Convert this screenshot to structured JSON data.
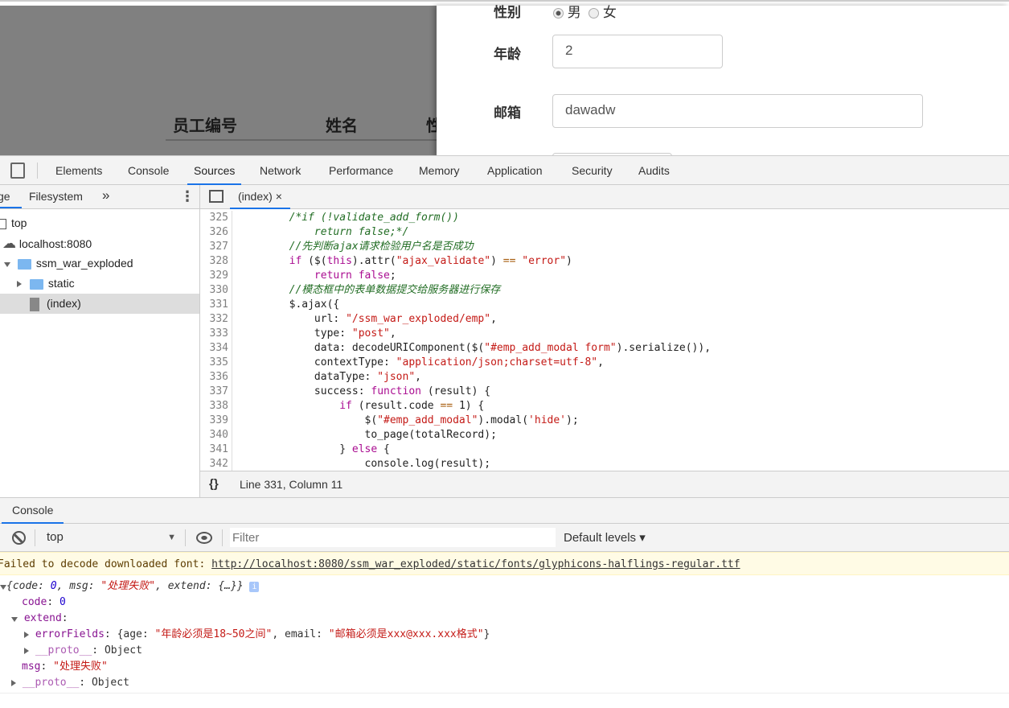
{
  "page": {
    "table_headers": [
      "员工编号",
      "姓名",
      "性"
    ],
    "form": {
      "gender_label": "性别",
      "gender_options": [
        {
          "label": "男",
          "checked": true
        },
        {
          "label": "女",
          "checked": false
        }
      ],
      "age_label": "年龄",
      "age_value": "2",
      "email_label": "邮箱",
      "email_value": "dawadw"
    }
  },
  "devtools": {
    "tabs": [
      "Elements",
      "Console",
      "Sources",
      "Network",
      "Performance",
      "Memory",
      "Application",
      "Security",
      "Audits"
    ],
    "active_tab": "Sources",
    "accent_color": "#1a73e8",
    "navigator": {
      "tabs": [
        "ge",
        "Filesystem"
      ],
      "more": "»",
      "tree": [
        {
          "label": "top",
          "icon": "frame-icon"
        },
        {
          "label": "localhost:8080",
          "icon": "cloud-icon"
        },
        {
          "label": "ssm_war_exploded",
          "icon": "folder-icon",
          "expanded": true
        },
        {
          "label": "static",
          "icon": "folder-icon",
          "expanded": false
        },
        {
          "label": "(index)",
          "icon": "file-icon",
          "selected": true
        }
      ]
    },
    "editor": {
      "tab": "(index)",
      "close": "×",
      "lines": [
        {
          "n": "325",
          "t": [
            [
              "p",
              "        "
            ],
            [
              "c",
              "/*if (!validate_add_form())"
            ]
          ]
        },
        {
          "n": "326",
          "t": [
            [
              "p",
              "            "
            ],
            [
              "c",
              "return false;*/"
            ]
          ]
        },
        {
          "n": "327",
          "t": [
            [
              "p",
              "        "
            ],
            [
              "c",
              "//先判断ajax请求检验用户名是否成功"
            ]
          ]
        },
        {
          "n": "328",
          "t": [
            [
              "p",
              "        "
            ],
            [
              "k",
              "if"
            ],
            [
              "p",
              " ($("
            ],
            [
              "k",
              "this"
            ],
            [
              "p",
              ").attr("
            ],
            [
              "s",
              "\"ajax_validate\""
            ],
            [
              "p",
              ") "
            ],
            [
              "o",
              "=="
            ],
            [
              "p",
              " "
            ],
            [
              "s",
              "\"error\""
            ],
            [
              "p",
              ")"
            ]
          ]
        },
        {
          "n": "329",
          "t": [
            [
              "p",
              "            "
            ],
            [
              "k",
              "return"
            ],
            [
              "p",
              " "
            ],
            [
              "k",
              "false"
            ],
            [
              "p",
              ";"
            ]
          ]
        },
        {
          "n": "330",
          "t": [
            [
              "p",
              "        "
            ],
            [
              "c",
              "//模态框中的表单数据提交给服务器进行保存"
            ]
          ]
        },
        {
          "n": "331",
          "t": [
            [
              "p",
              "        $.ajax({"
            ]
          ]
        },
        {
          "n": "332",
          "t": [
            [
              "p",
              "            url: "
            ],
            [
              "s",
              "\"/ssm_war_exploded/emp\""
            ],
            [
              "p",
              ","
            ]
          ]
        },
        {
          "n": "333",
          "t": [
            [
              "p",
              "            type: "
            ],
            [
              "s",
              "\"post\""
            ],
            [
              "p",
              ","
            ]
          ]
        },
        {
          "n": "334",
          "t": [
            [
              "p",
              "            data: decodeURIComponent($("
            ],
            [
              "s",
              "\"#emp_add_modal form\""
            ],
            [
              "p",
              ").serialize()),"
            ]
          ]
        },
        {
          "n": "335",
          "t": [
            [
              "p",
              "            contextType: "
            ],
            [
              "s",
              "\"application/json;charset=utf-8\""
            ],
            [
              "p",
              ","
            ]
          ]
        },
        {
          "n": "336",
          "t": [
            [
              "p",
              "            dataType: "
            ],
            [
              "s",
              "\"json\""
            ],
            [
              "p",
              ","
            ]
          ]
        },
        {
          "n": "337",
          "t": [
            [
              "p",
              "            success: "
            ],
            [
              "k",
              "function"
            ],
            [
              "p",
              " (result) {"
            ]
          ]
        },
        {
          "n": "338",
          "t": [
            [
              "p",
              "                "
            ],
            [
              "k",
              "if"
            ],
            [
              "p",
              " (result.code "
            ],
            [
              "o",
              "=="
            ],
            [
              "p",
              " 1) {"
            ]
          ]
        },
        {
          "n": "339",
          "t": [
            [
              "p",
              "                    $("
            ],
            [
              "s",
              "\"#emp_add_modal\""
            ],
            [
              "p",
              ").modal("
            ],
            [
              "s",
              "'hide'"
            ],
            [
              "p",
              ");"
            ]
          ]
        },
        {
          "n": "340",
          "t": [
            [
              "p",
              "                    to_page(totalRecord);"
            ]
          ]
        },
        {
          "n": "341",
          "t": [
            [
              "p",
              "                } "
            ],
            [
              "k",
              "else"
            ],
            [
              "p",
              " {"
            ]
          ]
        },
        {
          "n": "342",
          "t": [
            [
              "p",
              "                    console.log(result);"
            ]
          ]
        }
      ],
      "status": "Line 331, Column 11",
      "format_button": "{}"
    }
  },
  "console": {
    "drawer_tab": "Console",
    "context": "top",
    "filter_placeholder": "Filter",
    "levels": "Default levels ▾",
    "warning_prefix": "Failed to decode downloaded font: ",
    "warning_url": "http://localhost:8080/ssm_war_exploded/static/fonts/glyphicons-halflings-regular.ttf",
    "warning_bg": "#fffbe5",
    "object_summary": {
      "pre": "{code: ",
      "code": "0",
      "mid": ", msg: ",
      "msg": "\"处理失败\"",
      "post": ", extend: {…}}"
    },
    "info_badge": "i",
    "code_key": "code",
    "code_val": "0",
    "extend_key": "extend",
    "errorfields_key": "errorFields",
    "errorfields_pre": "{age: ",
    "age_msg": "\"年龄必须是18~50之间\"",
    "errorfields_mid": ", email: ",
    "email_msg": "\"邮箱必须是xxx@xxx.xxx格式\"",
    "errorfields_post": "}",
    "proto_key": "__proto__",
    "proto_val": "Object",
    "msg_key": "msg",
    "msg_val": "\"处理失败\""
  }
}
